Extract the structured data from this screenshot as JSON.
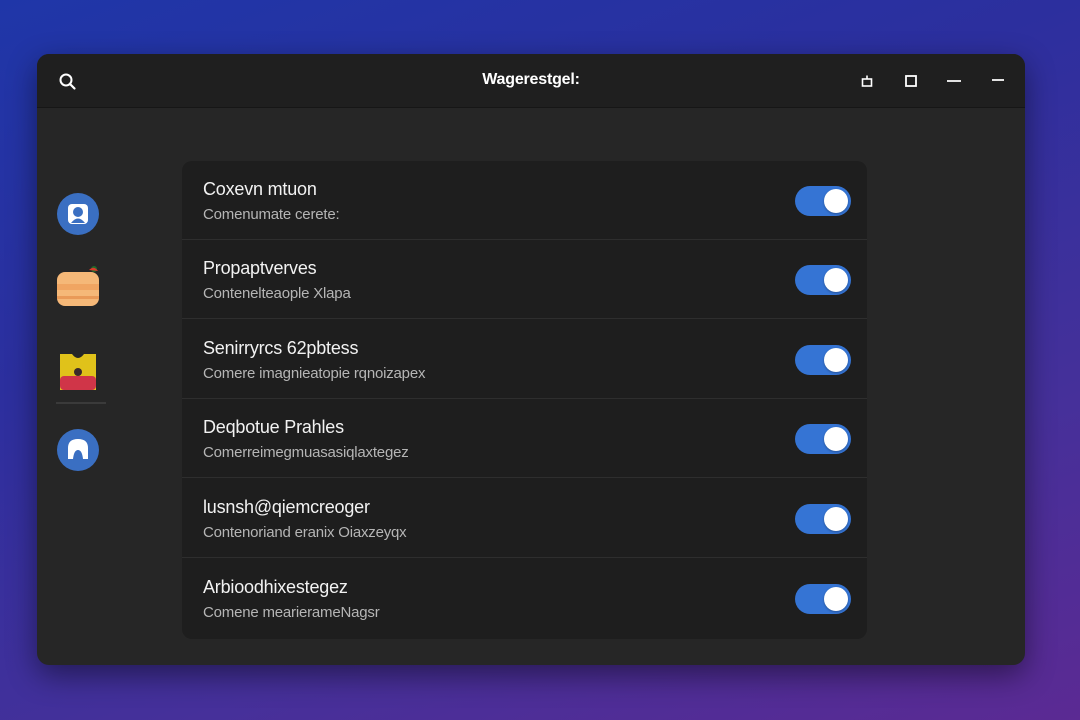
{
  "window": {
    "title": "Wagerestgel:"
  },
  "titlebar": {
    "search_icon": "search-icon",
    "controls": [
      "lock-icon",
      "maximize-icon",
      "minimize-icon",
      "minimize-icon"
    ]
  },
  "sidebar": {
    "items": [
      {
        "icon": "user-icon",
        "color": "#3a6fc2"
      },
      {
        "icon": "folder-icon",
        "color": "#f5b878"
      },
      {
        "icon": "flag-icon",
        "color": "#e0c21a"
      },
      {
        "icon": "account-icon",
        "color": "#3a6fc2"
      }
    ]
  },
  "settings": {
    "rows": [
      {
        "title": "Coxevn mtuon",
        "subtitle": "Comenumate cerete:",
        "enabled": true
      },
      {
        "title": "Propaptverves",
        "subtitle": "Contenelteaople Xlapa",
        "enabled": true
      },
      {
        "title": "Senirryrcs 62pbtess",
        "subtitle": "Comere imagnieatopie rqnoizapex",
        "enabled": true
      },
      {
        "title": "Deqbotue Prahles",
        "subtitle": "Comerreimegmuasasiqlaxtegez",
        "enabled": true
      },
      {
        "title": "lusnsh@qiemcreoger",
        "subtitle": "Contenoriand eranix Oiaxzeyqx",
        "enabled": true
      },
      {
        "title": "Arbioodhixestegez",
        "subtitle": "Comene mearierameNagsr",
        "enabled": true
      }
    ]
  },
  "colors": {
    "accent": "#3574d4",
    "window_bg": "#262626",
    "panel_bg": "#1e1e1e",
    "titlebar_bg": "#1f1f1f"
  }
}
